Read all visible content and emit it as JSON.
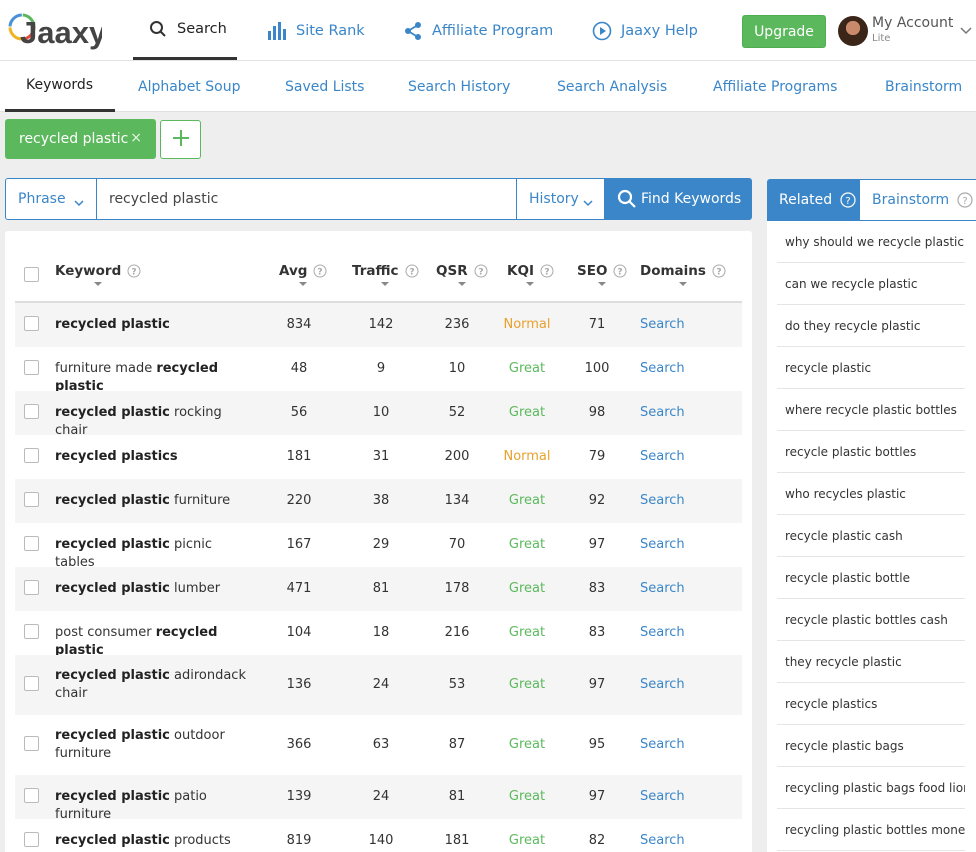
{
  "brand": {
    "logo_text": "Jaaxy"
  },
  "topnav": [
    {
      "label": "Search",
      "icon": "search-icon"
    },
    {
      "label": "Site Rank",
      "icon": "bar-chart-icon"
    },
    {
      "label": "Affiliate Program",
      "icon": "share-icon"
    },
    {
      "label": "Jaaxy Help",
      "icon": "play-circle-icon"
    }
  ],
  "upgrade_label": "Upgrade",
  "account": {
    "name": "My Account",
    "tier": "Lite"
  },
  "subnav": [
    "Keywords",
    "Alphabet Soup",
    "Saved Lists",
    "Search History",
    "Search Analysis",
    "Affiliate Programs",
    "Brainstorm"
  ],
  "chip": {
    "label": "recycled plastic",
    "close": "×"
  },
  "search": {
    "mode": "Phrase",
    "value": "recycled plastic",
    "history": "History",
    "button": "Find Keywords"
  },
  "table": {
    "headers": [
      "Keyword",
      "Avg",
      "Traffic",
      "QSR",
      "KQI",
      "SEO",
      "Domains"
    ],
    "rows": [
      {
        "pre": "",
        "bold": "recycled plastic",
        "post": "",
        "avg": "834",
        "traffic": "142",
        "qsr": "236",
        "kqi": "Normal",
        "seo": "71",
        "domains": "Search"
      },
      {
        "pre": "furniture made ",
        "bold": "recycled plastic",
        "post": "",
        "avg": "48",
        "traffic": "9",
        "qsr": "10",
        "kqi": "Great",
        "seo": "100",
        "domains": "Search"
      },
      {
        "pre": "",
        "bold": "recycled plastic",
        "post": " rocking chair",
        "avg": "56",
        "traffic": "10",
        "qsr": "52",
        "kqi": "Great",
        "seo": "98",
        "domains": "Search"
      },
      {
        "pre": "",
        "bold": "recycled plastics",
        "post": "",
        "avg": "181",
        "traffic": "31",
        "qsr": "200",
        "kqi": "Normal",
        "seo": "79",
        "domains": "Search"
      },
      {
        "pre": "",
        "bold": "recycled plastic",
        "post": " furniture",
        "avg": "220",
        "traffic": "38",
        "qsr": "134",
        "kqi": "Great",
        "seo": "92",
        "domains": "Search"
      },
      {
        "pre": "",
        "bold": "recycled plastic",
        "post": " picnic tables",
        "avg": "167",
        "traffic": "29",
        "qsr": "70",
        "kqi": "Great",
        "seo": "97",
        "domains": "Search"
      },
      {
        "pre": "",
        "bold": "recycled plastic",
        "post": " lumber",
        "avg": "471",
        "traffic": "81",
        "qsr": "178",
        "kqi": "Great",
        "seo": "83",
        "domains": "Search"
      },
      {
        "pre": "post consumer ",
        "bold": "recycled plastic",
        "post": "",
        "avg": "104",
        "traffic": "18",
        "qsr": "216",
        "kqi": "Great",
        "seo": "83",
        "domains": "Search"
      },
      {
        "pre": "",
        "bold": "recycled plastic",
        "post": " adirondack chair",
        "avg": "136",
        "traffic": "24",
        "qsr": "53",
        "kqi": "Great",
        "seo": "97",
        "domains": "Search"
      },
      {
        "pre": "",
        "bold": "recycled plastic",
        "post": " outdoor furniture",
        "avg": "366",
        "traffic": "63",
        "qsr": "87",
        "kqi": "Great",
        "seo": "95",
        "domains": "Search"
      },
      {
        "pre": "",
        "bold": "recycled plastic",
        "post": " patio furniture",
        "avg": "139",
        "traffic": "24",
        "qsr": "81",
        "kqi": "Great",
        "seo": "97",
        "domains": "Search"
      },
      {
        "pre": "",
        "bold": "recycled plastic",
        "post": " products",
        "avg": "819",
        "traffic": "140",
        "qsr": "181",
        "kqi": "Great",
        "seo": "82",
        "domains": "Search"
      }
    ]
  },
  "related": {
    "tabs": [
      "Related",
      "Brainstorm"
    ],
    "items": [
      "why should we recycle plastic",
      "can we recycle plastic",
      "do they recycle plastic",
      "recycle plastic",
      "where recycle plastic bottles",
      "recycle plastic bottles",
      "who recycles plastic",
      "recycle plastic cash",
      "recycle plastic bottle",
      "recycle plastic bottles cash",
      "they recycle plastic",
      "recycle plastics",
      "recycle plastic bags",
      "recycling plastic bags food lion",
      "recycling plastic bottles money"
    ]
  },
  "colors": {
    "accent": "#3a86c8",
    "green": "#5cb85c",
    "orange": "#e8a12c"
  }
}
